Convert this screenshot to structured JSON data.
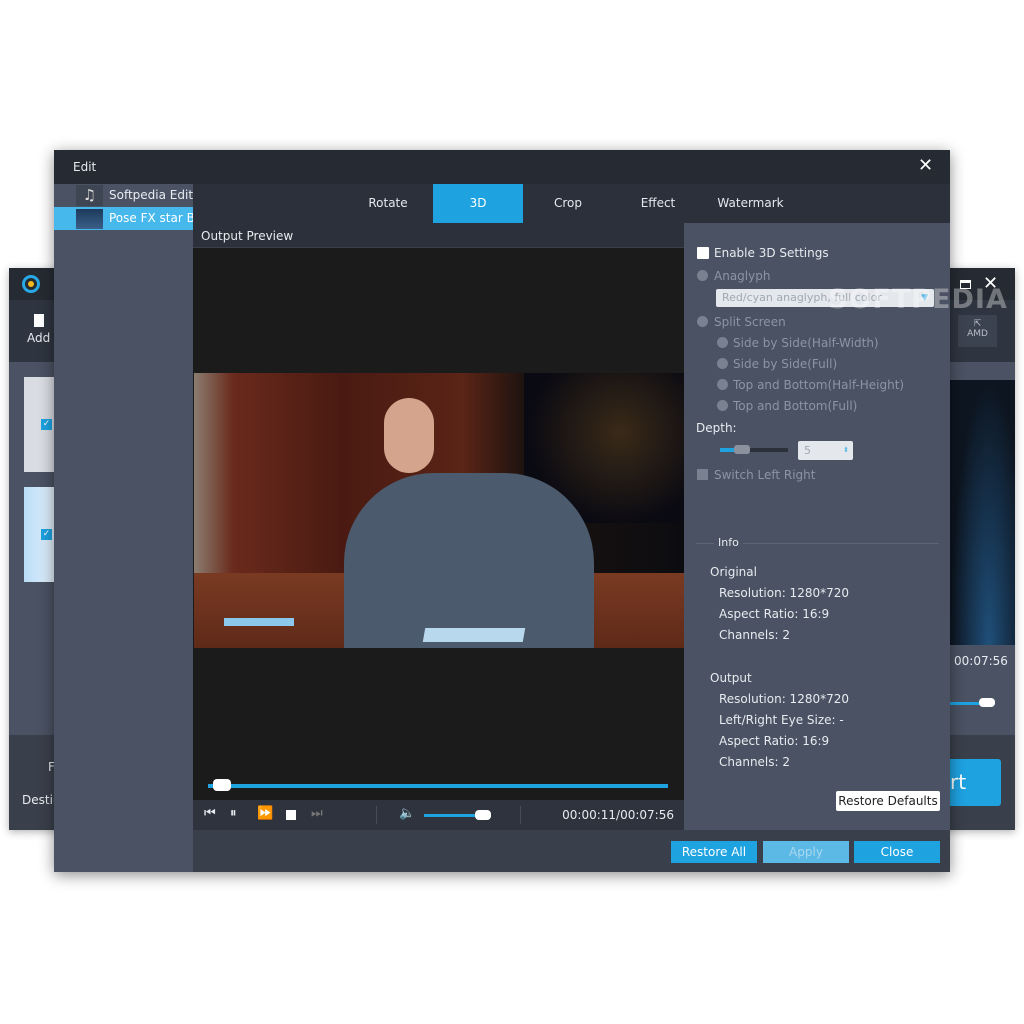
{
  "background_app": {
    "add_label": "Add",
    "left_labels": [
      "F",
      "Destin"
    ],
    "amd_label": "AMD",
    "time": "00:07:56",
    "convert_partial": "rt"
  },
  "watermark": "SOFTPEDIA",
  "dialog": {
    "title": "Edit",
    "files": [
      {
        "name": "Softpedia Edit...",
        "type": "audio",
        "selected": false
      },
      {
        "name": "Pose FX star B...",
        "type": "video",
        "selected": true
      }
    ],
    "tabs": [
      {
        "label": "Rotate"
      },
      {
        "label": "3D",
        "active": true
      },
      {
        "label": "Crop"
      },
      {
        "label": "Effect"
      },
      {
        "label": "Watermark"
      }
    ],
    "preview_label": "Output Preview",
    "player": {
      "current_time": "00:00:11/00:07:56",
      "progress": 0.023,
      "volume": 0.8
    },
    "settings": {
      "enable_3d_label": "Enable 3D Settings",
      "enable_3d_checked": false,
      "anaglyph_label": "Anaglyph",
      "anaglyph_option": "Red/cyan anaglyph, full color",
      "split_screen_label": "Split Screen",
      "split_options": [
        "Side by Side(Half-Width)",
        "Side by Side(Full)",
        "Top and Bottom(Half-Height)",
        "Top and Bottom(Full)"
      ],
      "depth_label": "Depth:",
      "depth_value": "5",
      "switch_label": "Switch Left Right"
    },
    "info": {
      "heading": "Info",
      "original_heading": "Original",
      "original": [
        "Resolution: 1280*720",
        "Aspect Ratio: 16:9",
        "Channels: 2"
      ],
      "output_heading": "Output",
      "output": [
        "Resolution: 1280*720",
        "Left/Right Eye Size: -",
        "Aspect Ratio: 16:9",
        "Channels: 2"
      ]
    },
    "restore_defaults": "Restore Defaults",
    "buttons": {
      "restore_all": "Restore All",
      "apply": "Apply",
      "close": "Close"
    },
    "accent": "#1ea2e0"
  }
}
